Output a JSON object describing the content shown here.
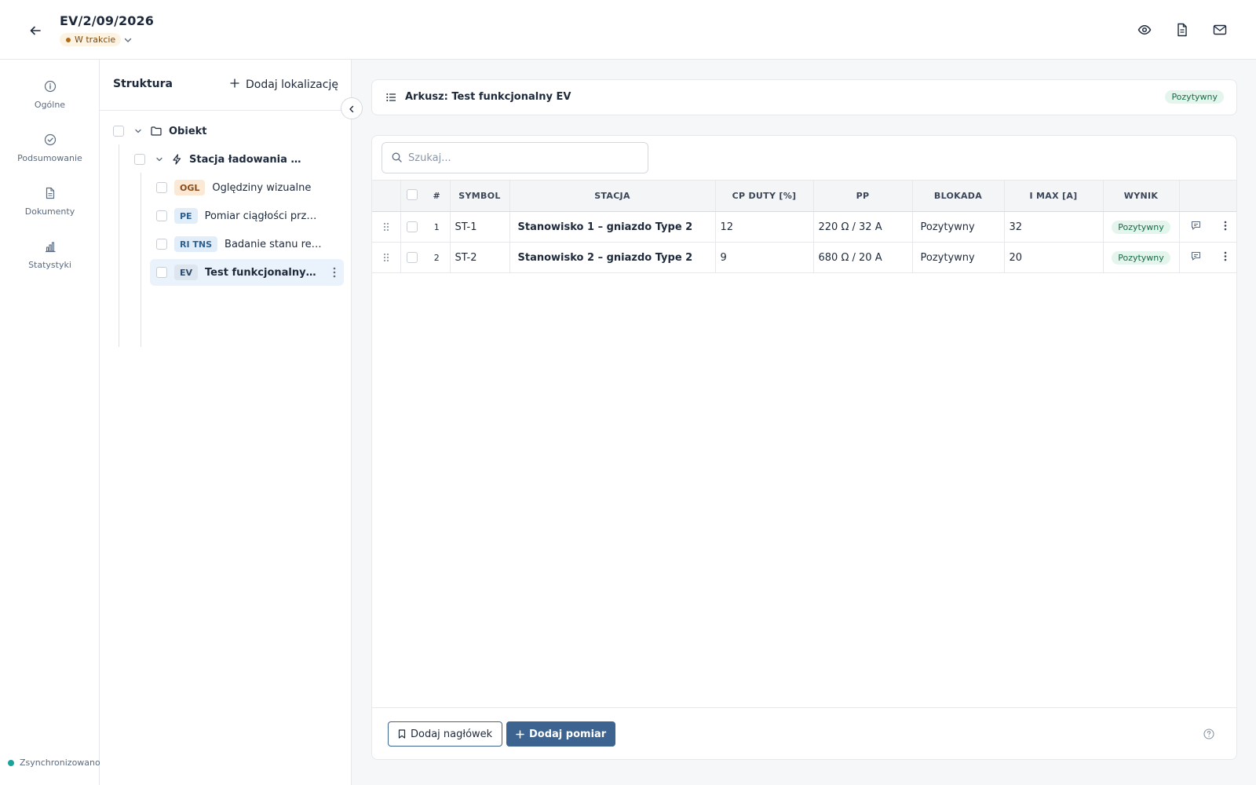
{
  "header": {
    "title": "EV/2/09/2026",
    "status": "W trakcie",
    "actions": [
      "eye-icon",
      "file-icon",
      "mail-icon"
    ]
  },
  "rail": {
    "items": [
      {
        "label": "Ogólne",
        "icon": "info-icon"
      },
      {
        "label": "Podsumowanie",
        "icon": "check-circle-icon"
      },
      {
        "label": "Dokumenty",
        "icon": "document-icon"
      },
      {
        "label": "Statystyki",
        "icon": "chart-icon"
      }
    ],
    "sync_status": "Zsynchronizowano"
  },
  "structure": {
    "title": "Struktura",
    "add_location": "Dodaj lokalizację",
    "root": "Obiekt",
    "station": "Stacja ładowania AC ...",
    "items": [
      {
        "tag": "OGL",
        "label": "Oględziny wizualne"
      },
      {
        "tag": "PE",
        "label": "Pomiar ciągłości przew..."
      },
      {
        "tag": "RI TNS",
        "label": "Badanie stanu rezy..."
      },
      {
        "tag": "EV",
        "label": "Test funkcjonalny sta..."
      }
    ]
  },
  "sheet": {
    "title": "Arkusz: Test funkcjonalny EV",
    "result": "Pozytywny"
  },
  "table": {
    "search_placeholder": "Szukaj...",
    "columns": [
      "#",
      "SYMBOL",
      "STACJA",
      "CP DUTY [%]",
      "PP",
      "BLOKADA",
      "I MAX [A]",
      "WYNIK"
    ],
    "rows": [
      {
        "num": "1",
        "symbol": "ST-1",
        "stacja": "Stanowisko 1 – gniazdo Type 2",
        "cp_duty": "12",
        "pp": "220 Ω / 32 A",
        "blokada": "Pozytywny",
        "imax": "32",
        "wynik": "Pozytywny"
      },
      {
        "num": "2",
        "symbol": "ST-2",
        "stacja": "Stanowisko 2 – gniazdo Type 2",
        "cp_duty": "9",
        "pp": "680 Ω / 20 A",
        "blokada": "Pozytywny",
        "imax": "20",
        "wynik": "Pozytywny"
      }
    ]
  },
  "footer": {
    "add_header": "Dodaj nagłówek",
    "add_measurement": "Dodaj pomiar"
  },
  "colors": {
    "primary": "#3d6390",
    "positive_bg": "#e3f5ec",
    "positive_text": "#166b46",
    "status_bg": "#fdf3e2",
    "sync_dot": "#1aa39a"
  }
}
